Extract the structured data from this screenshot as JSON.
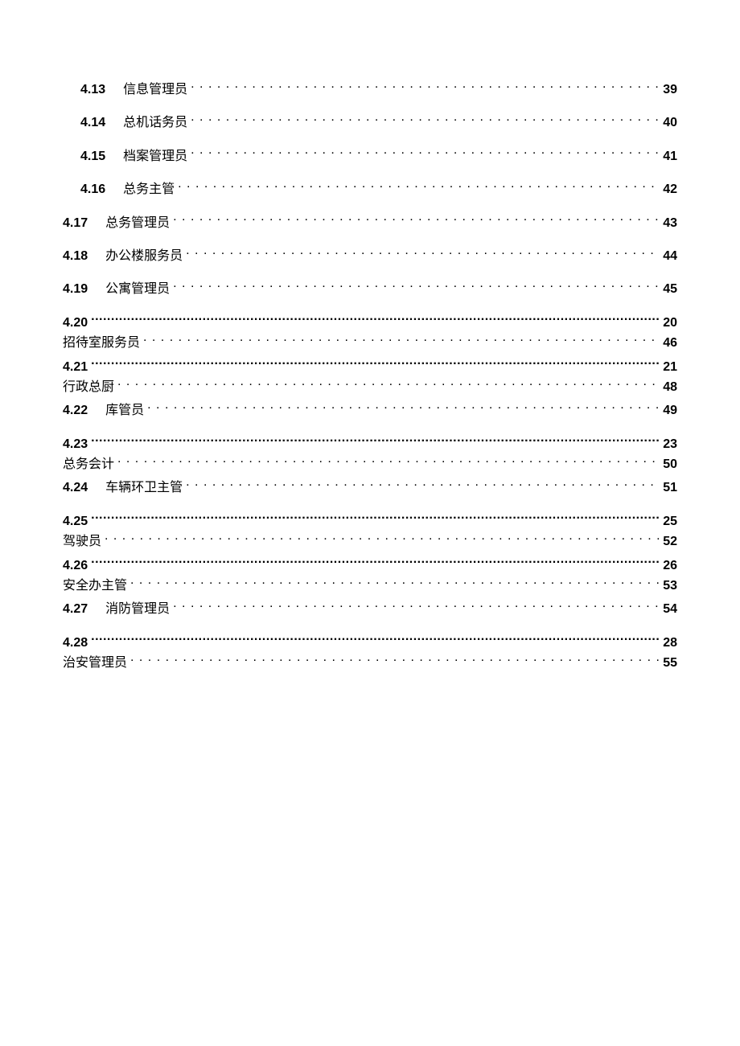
{
  "toc": [
    {
      "type": "single",
      "level": "A",
      "num": "4.13",
      "label": "信息管理员",
      "page": "39"
    },
    {
      "type": "single",
      "level": "A",
      "num": "4.14",
      "label": "总机话务员",
      "page": "40"
    },
    {
      "type": "single",
      "level": "A",
      "num": "4.15",
      "label": "档案管理员",
      "page": "41"
    },
    {
      "type": "single",
      "level": "A",
      "num": "4.16",
      "label": "总务主管",
      "page": "42"
    },
    {
      "type": "single",
      "level": "B",
      "num": "4.17",
      "label": "总务管理员",
      "page": "43"
    },
    {
      "type": "single",
      "level": "B",
      "num": "4.18",
      "label": "办公楼服务员",
      "page": "44"
    },
    {
      "type": "single",
      "level": "B",
      "num": "4.19",
      "label": "公寓管理员",
      "page": "45"
    },
    {
      "type": "split",
      "level": "C",
      "num": "4.20",
      "numpage": "20",
      "label": "招待室服务员",
      "page": "46"
    },
    {
      "type": "split",
      "level": "C",
      "num": "4.21",
      "numpage": "21",
      "label": "行政总厨",
      "page": "48"
    },
    {
      "type": "single",
      "level": "B",
      "num": "4.22",
      "label": "库管员",
      "page": "49"
    },
    {
      "type": "split",
      "level": "C",
      "num": "4.23",
      "numpage": "23",
      "label": "总务会计",
      "page": "50"
    },
    {
      "type": "single",
      "level": "B",
      "num": "4.24",
      "label": "车辆环卫主管",
      "page": "51"
    },
    {
      "type": "split",
      "level": "C",
      "num": "4.25",
      "numpage": "25",
      "label": "驾驶员",
      "page": "52"
    },
    {
      "type": "split",
      "level": "C",
      "num": "4.26",
      "numpage": "26",
      "label": "安全办主管",
      "page": "53"
    },
    {
      "type": "single",
      "level": "B",
      "num": "4.27",
      "label": "消防管理员",
      "page": "54"
    },
    {
      "type": "split",
      "level": "C",
      "num": "4.28",
      "numpage": "28",
      "label": "治安管理员",
      "page": "55"
    }
  ]
}
